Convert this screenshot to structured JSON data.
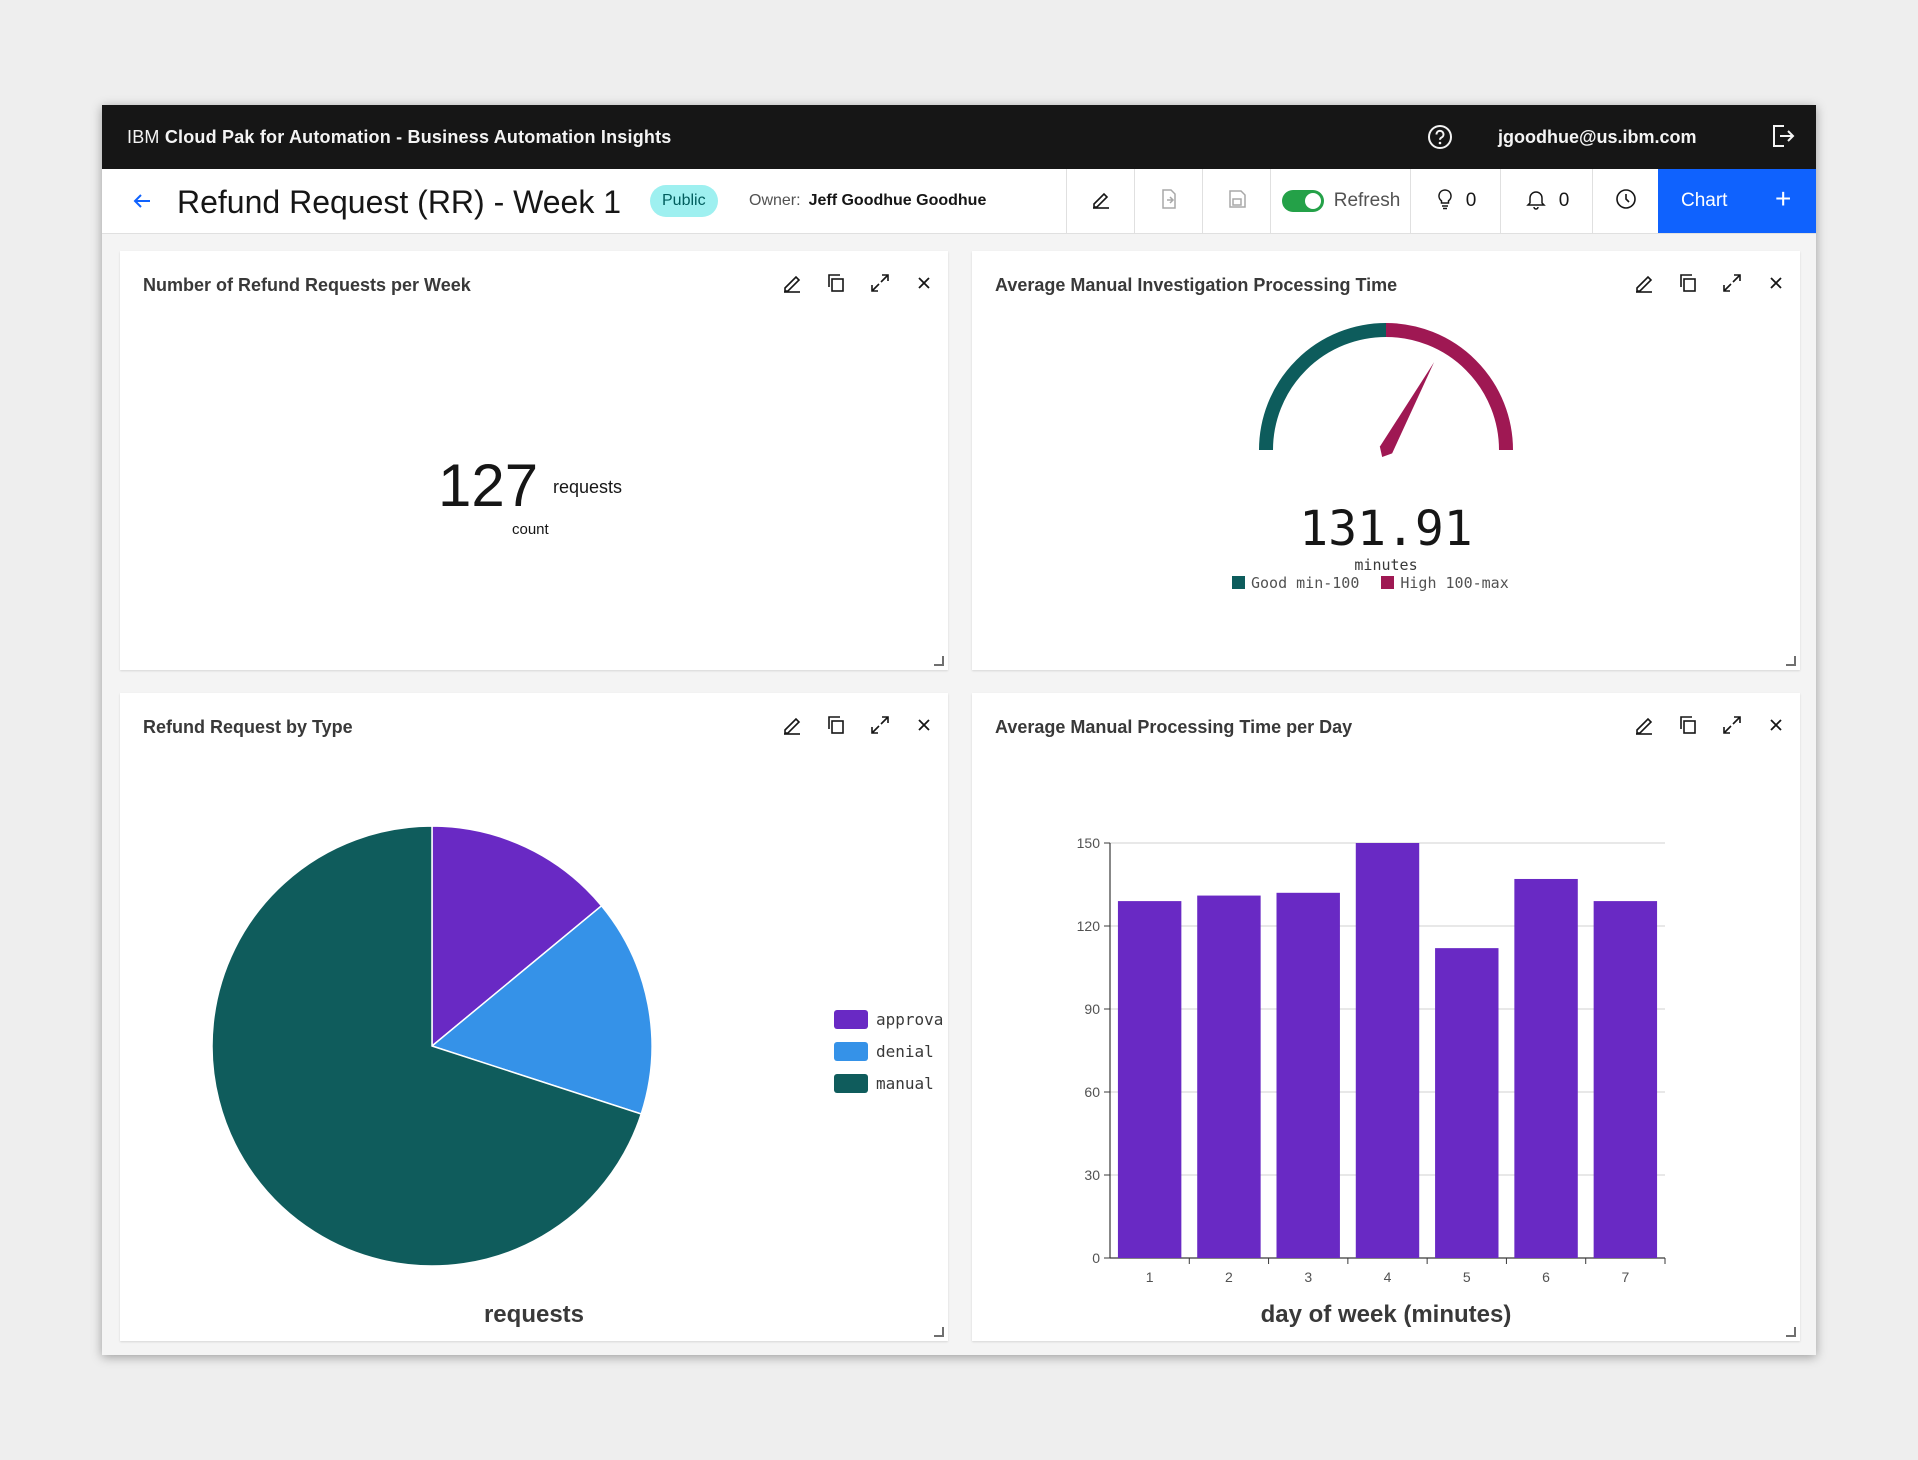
{
  "app": {
    "brand_prefix": "IBM",
    "brand_product": "Cloud Pak for Automation - Business Automation Insights",
    "user_email": "jgoodhue@us.ibm.com"
  },
  "toolbar": {
    "title": "Refund Request (RR) - Week 1",
    "visibility_badge": "Public",
    "owner_label": "Owner:",
    "owner_name": "Jeff Goodhue Goodhue",
    "refresh_label": "Refresh",
    "refresh_enabled": true,
    "ideas_count": "0",
    "notifications_count": "0",
    "chart_button_label": "Chart",
    "add_label": "+"
  },
  "tiles": {
    "requests_per_week": {
      "title": "Number of Refund Requests per Week",
      "value": "127",
      "unit": "requests",
      "subtitle": "count"
    },
    "processing_time": {
      "title": "Average Manual Investigation Processing Time",
      "value": "131.91",
      "unit": "minutes",
      "legend_good": "Good min-100",
      "legend_high": "High 100-max"
    },
    "by_type": {
      "title": "Refund Request by Type",
      "axis_title": "requests"
    },
    "per_day": {
      "title": "Average Manual Processing Time per Day",
      "axis_title": "day of week (minutes)"
    }
  },
  "colors": {
    "good": "#0d5c5c",
    "high": "#9f1853",
    "approval": "#6929c4",
    "denial": "#3592e8",
    "manual": "#0f5c5c",
    "bar": "#6929c4",
    "primary": "#0f62fe"
  },
  "chart_data": [
    {
      "type": "gauge",
      "value": 131.91,
      "unit": "minutes",
      "ranges": [
        {
          "name": "Good",
          "label": "Good min-100",
          "to": 100
        },
        {
          "name": "High",
          "label": "High 100-max",
          "from": 100
        }
      ],
      "max": 200
    },
    {
      "type": "pie",
      "title": "Refund Request by Type",
      "xlabel": "requests",
      "categories": [
        "approva",
        "denial",
        "manual"
      ],
      "values": [
        14,
        16,
        70
      ],
      "legend_position": "right"
    },
    {
      "type": "bar",
      "title": "Average Manual Processing Time per Day",
      "xlabel": "day of week (minutes)",
      "categories": [
        "1",
        "2",
        "3",
        "4",
        "5",
        "6",
        "7"
      ],
      "values": [
        129,
        131,
        132,
        150,
        112,
        137,
        129
      ],
      "ylim": [
        0,
        150
      ],
      "yticks": [
        0,
        30,
        60,
        90,
        120,
        150
      ],
      "grid": true
    }
  ]
}
